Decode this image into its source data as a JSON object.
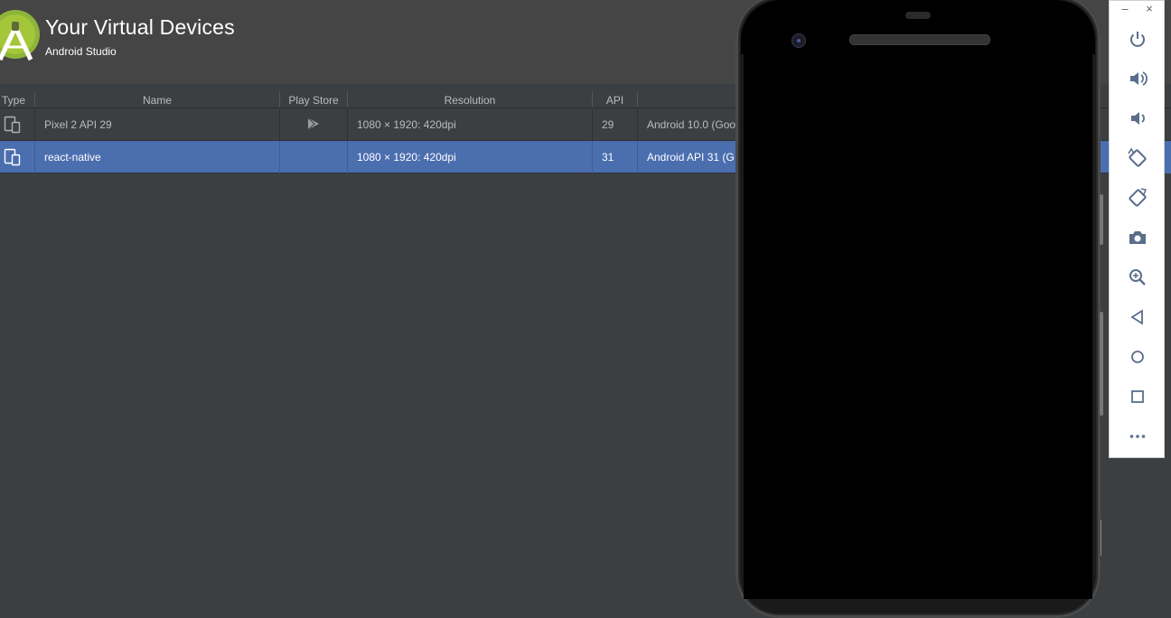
{
  "header": {
    "title": "Your Virtual Devices",
    "subtitle": "Android Studio"
  },
  "table": {
    "columns": [
      "Type",
      "Name",
      "Play Store",
      "Resolution",
      "API",
      ""
    ],
    "rows": [
      {
        "name": "Pixel 2 API 29",
        "play_store": true,
        "resolution": "1080 × 1920: 420dpi",
        "api": "29",
        "target": "Android 10.0 (Goo",
        "selected": false
      },
      {
        "name": "react-native",
        "play_store": false,
        "resolution": "1080 × 1920: 420dpi",
        "api": "31",
        "target": "Android API 31 (G",
        "selected": true
      }
    ]
  },
  "emulator_toolbar": {
    "window_buttons": {
      "minimize": "–",
      "close": "×"
    },
    "buttons": [
      {
        "icon": "power-icon"
      },
      {
        "icon": "volume-up-icon"
      },
      {
        "icon": "volume-down-icon"
      },
      {
        "icon": "rotate-left-icon"
      },
      {
        "icon": "rotate-right-icon"
      },
      {
        "icon": "camera-icon"
      },
      {
        "icon": "zoom-icon"
      },
      {
        "icon": "back-icon"
      },
      {
        "icon": "home-icon"
      },
      {
        "icon": "overview-icon"
      },
      {
        "icon": "more-icon"
      }
    ]
  },
  "colors": {
    "background": "#3c3f41",
    "header": "#454545",
    "selection": "#4b6eaf",
    "android_green": "#a4c639"
  }
}
